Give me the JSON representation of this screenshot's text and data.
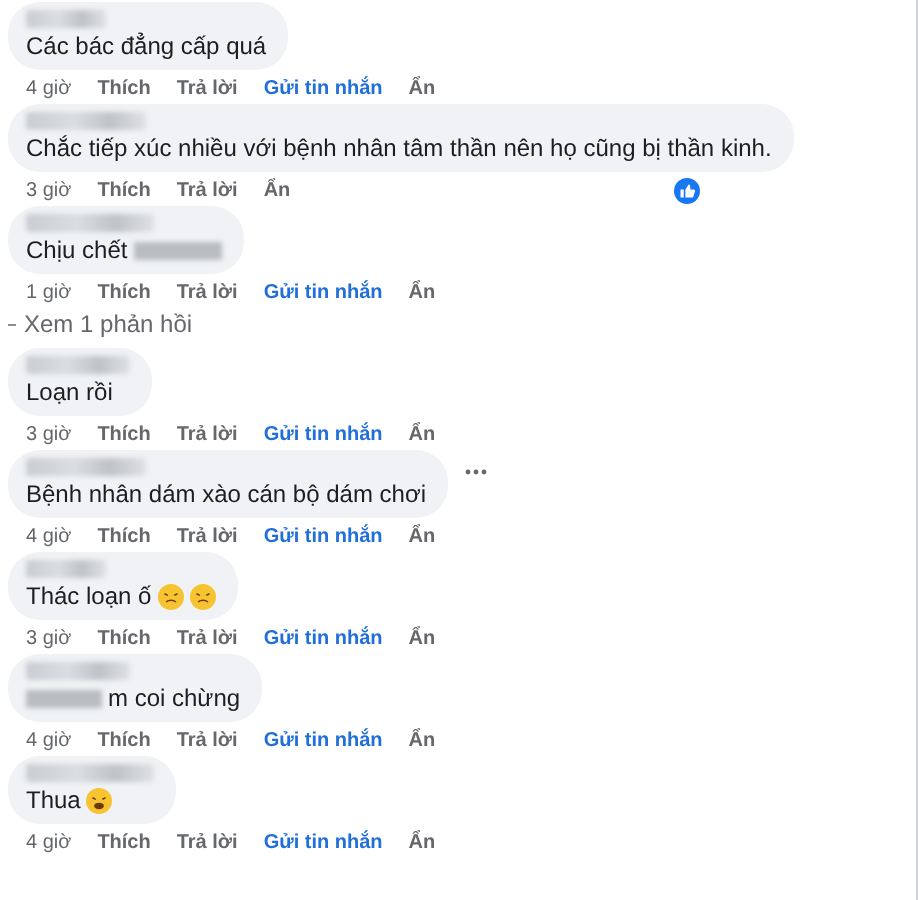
{
  "comments": [
    {
      "kind": "comment",
      "text": "Các bác đẳng cấp quá",
      "time": "4 giờ",
      "actions": [
        {
          "label": "Thích",
          "kind": "plain"
        },
        {
          "label": "Trả lời",
          "kind": "plain"
        },
        {
          "label": "Gửi tin nhắn",
          "kind": "link"
        },
        {
          "label": "Ẩn",
          "kind": "plain"
        }
      ]
    },
    {
      "kind": "comment",
      "text": "Chắc tiếp xúc nhiều với bệnh nhân tâm thần nên họ cũng bị thần kinh.",
      "reacted": true,
      "time": "3 giờ",
      "actions": [
        {
          "label": "Thích",
          "kind": "plain"
        },
        {
          "label": "Trả lời",
          "kind": "plain"
        },
        {
          "label": "Ẩn",
          "kind": "plain"
        }
      ]
    },
    {
      "kind": "comment",
      "text": "Chịu chết",
      "blur_after": true,
      "time": "1 giờ",
      "actions": [
        {
          "label": "Thích",
          "kind": "plain"
        },
        {
          "label": "Trả lời",
          "kind": "plain"
        },
        {
          "label": "Gửi tin nhắn",
          "kind": "link"
        },
        {
          "label": "Ẩn",
          "kind": "plain"
        }
      ]
    },
    {
      "kind": "replies_link",
      "text": "Xem 1 phản hồi"
    },
    {
      "kind": "comment",
      "text": "Loạn rồi",
      "time": "3 giờ",
      "actions": [
        {
          "label": "Thích",
          "kind": "plain"
        },
        {
          "label": "Trả lời",
          "kind": "plain"
        },
        {
          "label": "Gửi tin nhắn",
          "kind": "link"
        },
        {
          "label": "Ẩn",
          "kind": "plain"
        }
      ]
    },
    {
      "kind": "comment",
      "text": "Bệnh nhân dám xào cán bộ dám chơi",
      "more_menu": true,
      "time": "4 giờ",
      "actions": [
        {
          "label": "Thích",
          "kind": "plain"
        },
        {
          "label": "Trả lời",
          "kind": "plain"
        },
        {
          "label": "Gửi tin nhắn",
          "kind": "link"
        },
        {
          "label": "Ẩn",
          "kind": "plain"
        }
      ]
    },
    {
      "kind": "comment",
      "text": "Thác loạn ố",
      "emojis": [
        {
          "kind": "persevere"
        },
        {
          "kind": "persevere"
        }
      ],
      "time": "3 giờ",
      "actions": [
        {
          "label": "Thích",
          "kind": "plain"
        },
        {
          "label": "Trả lời",
          "kind": "plain"
        },
        {
          "label": "Gửi tin nhắn",
          "kind": "link"
        },
        {
          "label": "Ẩn",
          "kind": "plain"
        }
      ]
    },
    {
      "kind": "comment",
      "text": "m coi chừng",
      "blur_before": true,
      "time": "4 giờ",
      "actions": [
        {
          "label": "Thích",
          "kind": "plain"
        },
        {
          "label": "Trả lời",
          "kind": "plain"
        },
        {
          "label": "Gửi tin nhắn",
          "kind": "link"
        },
        {
          "label": "Ẩn",
          "kind": "plain"
        }
      ]
    },
    {
      "kind": "comment",
      "text": "Thua",
      "emojis": [
        {
          "kind": "weary"
        }
      ],
      "time": "4 giờ",
      "actions": [
        {
          "label": "Thích",
          "kind": "plain"
        },
        {
          "label": "Trả lời",
          "kind": "plain"
        },
        {
          "label": "Gửi tin nhắn",
          "kind": "link"
        },
        {
          "label": "Ẩn",
          "kind": "plain"
        }
      ]
    }
  ]
}
